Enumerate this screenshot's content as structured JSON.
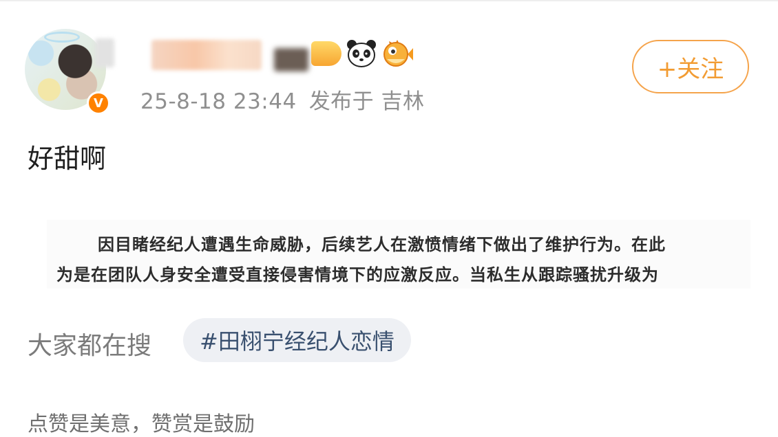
{
  "post": {
    "timestamp": "25-8-18 23:44",
    "location": "发布于 吉林",
    "follow_label": "+关注",
    "level_badge": "",
    "content": "好甜啊",
    "quote": {
      "line1": "因目睹经纪人遭遇生命威胁，后续艺人在激愤情绪下做出了维护行为。在此",
      "line2": "为是在团队人身安全遭受直接侵害情境下的应激反应。当私生从跟踪骚扰升级为"
    }
  },
  "trending": {
    "label": "大家都在搜",
    "topic": "#田栩宁经纪人恋情"
  },
  "footer": {
    "text": "点赞是美意，赞赏是鼓励"
  },
  "icons": {
    "verified": "verified-badge-icon",
    "panda": "panda-icon",
    "fish": "pufferfish-icon"
  },
  "colors": {
    "accent": "#ff8200",
    "follow": "#f29c33",
    "meta": "#8f8f8f",
    "topic": "#39506f"
  }
}
